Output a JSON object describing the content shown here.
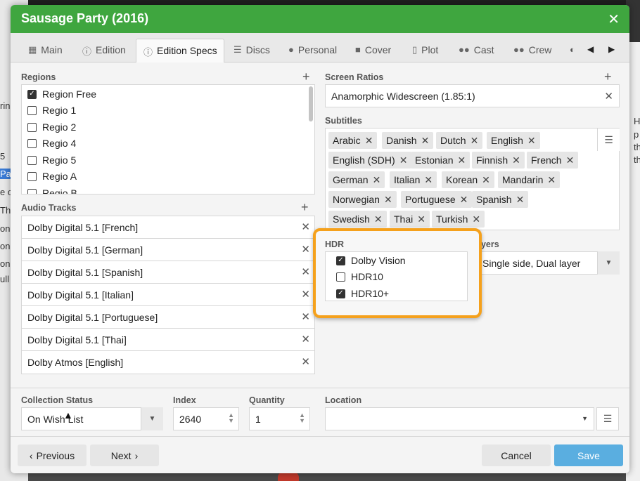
{
  "background": {
    "left_texts": [
      "ring",
      "5",
      "Par",
      "e o",
      "Th",
      "one",
      "one",
      "one",
      "ull"
    ],
    "right_texts": [
      "H",
      "p",
      "th",
      "th"
    ]
  },
  "dialog": {
    "title": "Sausage Party (2016)",
    "close_icon": "close-icon"
  },
  "tabs": [
    {
      "label": "Main",
      "icon": "film-icon"
    },
    {
      "label": "Edition",
      "icon": "info-icon"
    },
    {
      "label": "Edition Specs",
      "icon": "info-icon"
    },
    {
      "label": "Discs",
      "icon": "list-icon"
    },
    {
      "label": "Personal",
      "icon": "person-icon"
    },
    {
      "label": "Cover",
      "icon": "camera-icon"
    },
    {
      "label": "Plot",
      "icon": "document-icon"
    },
    {
      "label": "Cast",
      "icon": "people-icon"
    },
    {
      "label": "Crew",
      "icon": "people-icon"
    }
  ],
  "regions": {
    "label": "Regions",
    "items": [
      {
        "label": "Region Free",
        "checked": true
      },
      {
        "label": "Regio 1",
        "checked": false
      },
      {
        "label": "Regio 2",
        "checked": false
      },
      {
        "label": "Regio 4",
        "checked": false
      },
      {
        "label": "Regio 5",
        "checked": false
      },
      {
        "label": "Regio A",
        "checked": false
      },
      {
        "label": "Regio B",
        "checked": false
      }
    ]
  },
  "audio_tracks": {
    "label": "Audio Tracks",
    "items": [
      "Dolby Digital 5.1 [French]",
      "Dolby Digital 5.1 [German]",
      "Dolby Digital 5.1 [Spanish]",
      "Dolby Digital 5.1 [Italian]",
      "Dolby Digital 5.1 [Portuguese]",
      "Dolby Digital 5.1 [Thai]",
      "Dolby Atmos [English]"
    ]
  },
  "screen_ratios": {
    "label": "Screen Ratios",
    "value": "Anamorphic Widescreen (1.85:1)"
  },
  "subtitles": {
    "label": "Subtitles",
    "items": [
      "Arabic",
      "Danish",
      "Dutch",
      "English",
      "English (SDH)",
      "Estonian",
      "Finnish",
      "French",
      "German",
      "Italian",
      "Korean",
      "Mandarin",
      "Norwegian",
      "Portuguese",
      "Spanish",
      "Swedish",
      "Thai",
      "Turkish"
    ]
  },
  "hdr": {
    "label": "HDR",
    "items": [
      {
        "label": "Dolby Vision",
        "checked": true
      },
      {
        "label": "HDR10",
        "checked": false
      },
      {
        "label": "HDR10+",
        "checked": true
      }
    ],
    "highlight_color": "#f5a11c"
  },
  "layers": {
    "label_partial": "ayers",
    "value": "Single side, Dual layer"
  },
  "collection_status": {
    "label": "Collection Status",
    "value": "On Wish List"
  },
  "index": {
    "label": "Index",
    "value": "2640"
  },
  "quantity": {
    "label": "Quantity",
    "value": "1"
  },
  "location": {
    "label": "Location",
    "value": ""
  },
  "buttons": {
    "previous": "Previous",
    "next": "Next",
    "cancel": "Cancel",
    "save": "Save"
  },
  "colors": {
    "title_bar": "#3fa63f",
    "save_button": "#5aaee0",
    "highlight": "#f5a11c"
  }
}
